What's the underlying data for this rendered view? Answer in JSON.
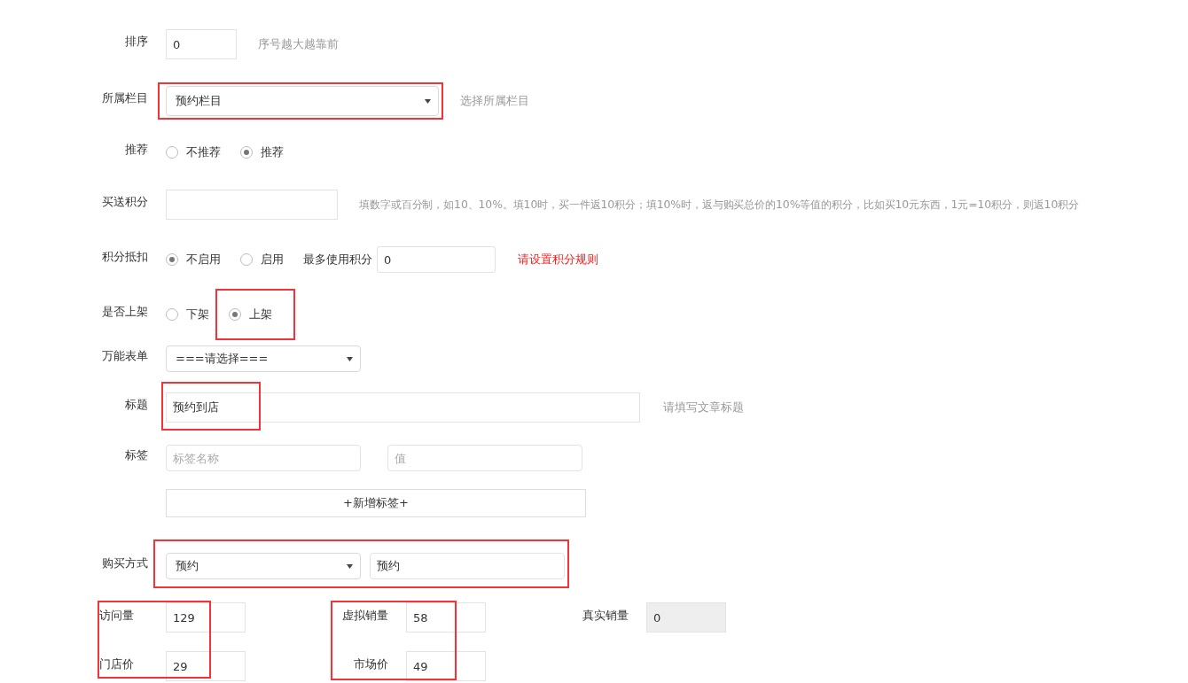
{
  "sort": {
    "label": "排序",
    "value": "0",
    "hint": "序号越大越靠前"
  },
  "category": {
    "label": "所属栏目",
    "value": "预约栏目",
    "hint": "选择所属栏目",
    "highlighted": true
  },
  "recommend": {
    "label": "推荐",
    "options": [
      {
        "label": "不推荐",
        "selected": false
      },
      {
        "label": "推荐",
        "selected": true
      }
    ]
  },
  "bonus_points": {
    "label": "买送积分",
    "hint": "填数字或百分制，如10、10%。填10时，买一件返10积分；填10%时，返与购买总价的10%等值的积分，比如买10元东西，1元=10积分，则返10积分"
  },
  "points_deduction": {
    "label": "积分抵扣",
    "options": [
      {
        "label": "不启用",
        "selected": true
      },
      {
        "label": "启用",
        "selected": false
      }
    ],
    "max_label": "最多使用积分",
    "max_value": "0",
    "warning": "请设置积分规则"
  },
  "listing": {
    "label": "是否上架",
    "options": [
      {
        "label": "下架",
        "selected": false,
        "highlighted": false
      },
      {
        "label": "上架",
        "selected": true,
        "highlighted": true
      }
    ]
  },
  "form": {
    "label": "万能表单",
    "value": "===请选择==="
  },
  "title": {
    "label": "标题",
    "value": "预约到店",
    "hint": "请填写文章标题",
    "highlighted": true
  },
  "tags": {
    "label": "标签",
    "name_placeholder": "标签名称",
    "value_placeholder": "值",
    "add_button": "+新增标签+"
  },
  "purchase": {
    "label": "购买方式",
    "mode": "预约",
    "text": "预约",
    "highlighted": true
  },
  "stats": [
    {
      "highlighted": true,
      "fields": [
        {
          "label": "访问量",
          "value": "129",
          "disabled": false
        },
        {
          "label": "门店价",
          "value": "29",
          "disabled": false
        }
      ]
    },
    {
      "highlighted": true,
      "fields": [
        {
          "label": "虚拟销量",
          "value": "58",
          "disabled": false
        },
        {
          "label": "市场价",
          "value": "49",
          "disabled": false
        }
      ]
    },
    {
      "highlighted": false,
      "fields": [
        {
          "label": "真实销量",
          "value": "0",
          "disabled": true
        }
      ]
    }
  ]
}
